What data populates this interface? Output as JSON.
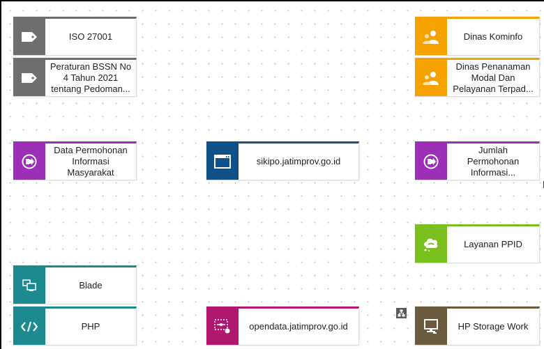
{
  "nodes": [
    {
      "id": "iso",
      "name": "iso-27001-node",
      "label": [
        "ISO 27001"
      ],
      "icon": "tag-icon",
      "color": "#6e6e6e"
    },
    {
      "id": "bssn",
      "name": "peraturan-bssn-node",
      "label": [
        "Peraturan BSSN No",
        "4 Tahun 2021",
        "tentang Pedoman..."
      ],
      "icon": "tag-icon",
      "color": "#6e6e6e"
    },
    {
      "id": "kominfo",
      "name": "dinas-kominfo-node",
      "label": [
        "Dinas Kominfo"
      ],
      "icon": "group-icon",
      "color": "#f5a100"
    },
    {
      "id": "dpmptsp",
      "name": "dinas-penanaman-modal-node",
      "label": [
        "Dinas Penanaman",
        "Modal Dan",
        "Pelayanan Terpad..."
      ],
      "icon": "group-icon",
      "color": "#f5a100"
    },
    {
      "id": "dpim",
      "name": "data-permohonan-informasi-node",
      "label": [
        "Data Permohonan",
        "Informasi",
        "Masyarakat"
      ],
      "icon": "data-flow-icon",
      "color": "#9b2fb5"
    },
    {
      "id": "sikipo",
      "name": "sikipo-application-node",
      "label": [
        "sikipo.jatimprov.go.id"
      ],
      "icon": "browser-window-icon",
      "color": "#0f4f8a"
    },
    {
      "id": "jpi",
      "name": "jumlah-permohonan-informasi-node",
      "label": [
        "Jumlah",
        "Permohonan",
        "Informasi..."
      ],
      "icon": "data-flow-icon",
      "color": "#9b2fb5"
    },
    {
      "id": "ppid",
      "name": "layanan-ppid-node",
      "label": [
        "Layanan PPID"
      ],
      "icon": "service-icon",
      "color": "#7bbf1e"
    },
    {
      "id": "blade",
      "name": "blade-node",
      "label": [
        "Blade"
      ],
      "icon": "devices-icon",
      "color": "#1d8a8f"
    },
    {
      "id": "php",
      "name": "php-node",
      "label": [
        "PHP"
      ],
      "icon": "code-icon",
      "color": "#1d8a8f"
    },
    {
      "id": "opendata",
      "name": "opendata-node",
      "label": [
        "opendata.jatimprov.go.id"
      ],
      "icon": "interface-icon",
      "color": "#b0186e"
    },
    {
      "id": "hp",
      "name": "hp-storage-node",
      "label": [
        "HP Storage Work"
      ],
      "icon": "computer-icon",
      "color": "#6b5b3e"
    }
  ],
  "hierarchy_chip": {
    "icon": "hierarchy-icon"
  }
}
